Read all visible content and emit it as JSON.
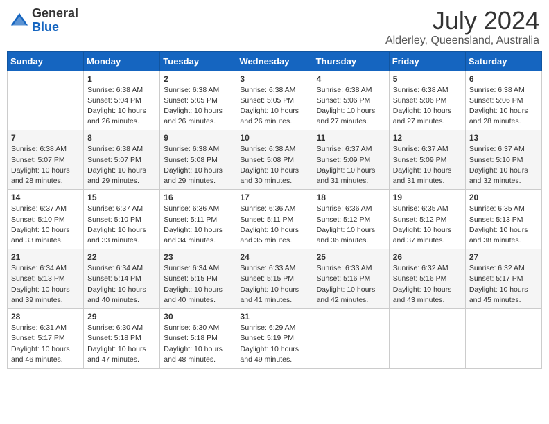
{
  "header": {
    "logo_line1": "General",
    "logo_line2": "Blue",
    "month": "July 2024",
    "location": "Alderley, Queensland, Australia"
  },
  "weekdays": [
    "Sunday",
    "Monday",
    "Tuesday",
    "Wednesday",
    "Thursday",
    "Friday",
    "Saturday"
  ],
  "weeks": [
    [
      {
        "day": "",
        "info": ""
      },
      {
        "day": "1",
        "info": "Sunrise: 6:38 AM\nSunset: 5:04 PM\nDaylight: 10 hours\nand 26 minutes."
      },
      {
        "day": "2",
        "info": "Sunrise: 6:38 AM\nSunset: 5:05 PM\nDaylight: 10 hours\nand 26 minutes."
      },
      {
        "day": "3",
        "info": "Sunrise: 6:38 AM\nSunset: 5:05 PM\nDaylight: 10 hours\nand 26 minutes."
      },
      {
        "day": "4",
        "info": "Sunrise: 6:38 AM\nSunset: 5:06 PM\nDaylight: 10 hours\nand 27 minutes."
      },
      {
        "day": "5",
        "info": "Sunrise: 6:38 AM\nSunset: 5:06 PM\nDaylight: 10 hours\nand 27 minutes."
      },
      {
        "day": "6",
        "info": "Sunrise: 6:38 AM\nSunset: 5:06 PM\nDaylight: 10 hours\nand 28 minutes."
      }
    ],
    [
      {
        "day": "7",
        "info": "Sunrise: 6:38 AM\nSunset: 5:07 PM\nDaylight: 10 hours\nand 28 minutes."
      },
      {
        "day": "8",
        "info": "Sunrise: 6:38 AM\nSunset: 5:07 PM\nDaylight: 10 hours\nand 29 minutes."
      },
      {
        "day": "9",
        "info": "Sunrise: 6:38 AM\nSunset: 5:08 PM\nDaylight: 10 hours\nand 29 minutes."
      },
      {
        "day": "10",
        "info": "Sunrise: 6:38 AM\nSunset: 5:08 PM\nDaylight: 10 hours\nand 30 minutes."
      },
      {
        "day": "11",
        "info": "Sunrise: 6:37 AM\nSunset: 5:09 PM\nDaylight: 10 hours\nand 31 minutes."
      },
      {
        "day": "12",
        "info": "Sunrise: 6:37 AM\nSunset: 5:09 PM\nDaylight: 10 hours\nand 31 minutes."
      },
      {
        "day": "13",
        "info": "Sunrise: 6:37 AM\nSunset: 5:10 PM\nDaylight: 10 hours\nand 32 minutes."
      }
    ],
    [
      {
        "day": "14",
        "info": "Sunrise: 6:37 AM\nSunset: 5:10 PM\nDaylight: 10 hours\nand 33 minutes."
      },
      {
        "day": "15",
        "info": "Sunrise: 6:37 AM\nSunset: 5:10 PM\nDaylight: 10 hours\nand 33 minutes."
      },
      {
        "day": "16",
        "info": "Sunrise: 6:36 AM\nSunset: 5:11 PM\nDaylight: 10 hours\nand 34 minutes."
      },
      {
        "day": "17",
        "info": "Sunrise: 6:36 AM\nSunset: 5:11 PM\nDaylight: 10 hours\nand 35 minutes."
      },
      {
        "day": "18",
        "info": "Sunrise: 6:36 AM\nSunset: 5:12 PM\nDaylight: 10 hours\nand 36 minutes."
      },
      {
        "day": "19",
        "info": "Sunrise: 6:35 AM\nSunset: 5:12 PM\nDaylight: 10 hours\nand 37 minutes."
      },
      {
        "day": "20",
        "info": "Sunrise: 6:35 AM\nSunset: 5:13 PM\nDaylight: 10 hours\nand 38 minutes."
      }
    ],
    [
      {
        "day": "21",
        "info": "Sunrise: 6:34 AM\nSunset: 5:13 PM\nDaylight: 10 hours\nand 39 minutes."
      },
      {
        "day": "22",
        "info": "Sunrise: 6:34 AM\nSunset: 5:14 PM\nDaylight: 10 hours\nand 40 minutes."
      },
      {
        "day": "23",
        "info": "Sunrise: 6:34 AM\nSunset: 5:15 PM\nDaylight: 10 hours\nand 40 minutes."
      },
      {
        "day": "24",
        "info": "Sunrise: 6:33 AM\nSunset: 5:15 PM\nDaylight: 10 hours\nand 41 minutes."
      },
      {
        "day": "25",
        "info": "Sunrise: 6:33 AM\nSunset: 5:16 PM\nDaylight: 10 hours\nand 42 minutes."
      },
      {
        "day": "26",
        "info": "Sunrise: 6:32 AM\nSunset: 5:16 PM\nDaylight: 10 hours\nand 43 minutes."
      },
      {
        "day": "27",
        "info": "Sunrise: 6:32 AM\nSunset: 5:17 PM\nDaylight: 10 hours\nand 45 minutes."
      }
    ],
    [
      {
        "day": "28",
        "info": "Sunrise: 6:31 AM\nSunset: 5:17 PM\nDaylight: 10 hours\nand 46 minutes."
      },
      {
        "day": "29",
        "info": "Sunrise: 6:30 AM\nSunset: 5:18 PM\nDaylight: 10 hours\nand 47 minutes."
      },
      {
        "day": "30",
        "info": "Sunrise: 6:30 AM\nSunset: 5:18 PM\nDaylight: 10 hours\nand 48 minutes."
      },
      {
        "day": "31",
        "info": "Sunrise: 6:29 AM\nSunset: 5:19 PM\nDaylight: 10 hours\nand 49 minutes."
      },
      {
        "day": "",
        "info": ""
      },
      {
        "day": "",
        "info": ""
      },
      {
        "day": "",
        "info": ""
      }
    ]
  ]
}
